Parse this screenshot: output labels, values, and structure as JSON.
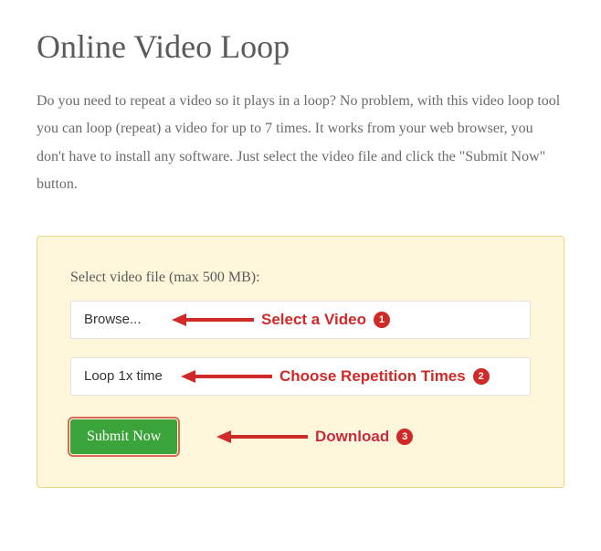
{
  "page": {
    "title": "Online Video Loop",
    "description": "Do you need to repeat a video so it plays in a loop? No problem, with this video loop tool you can loop (repeat) a video for up to 7 times. It works from your web browser, you don't have to install any software. Just select the video file and click the \"Submit Now\" button."
  },
  "form": {
    "field_label": "Select video file (max 500 MB):",
    "browse_label": "Browse...",
    "loop_select_value": "Loop 1x time",
    "submit_label": "Submit Now"
  },
  "annotations": {
    "step1": {
      "text": "Select a Video",
      "num": "1"
    },
    "step2": {
      "text": "Choose Repetition Times",
      "num": "2"
    },
    "step3": {
      "text": "Download",
      "num": "3"
    }
  },
  "colors": {
    "panel_bg": "#fdf6da",
    "panel_border": "#e8d98a",
    "submit_bg": "#3aa33a",
    "annotation_red": "#cf2a27"
  }
}
